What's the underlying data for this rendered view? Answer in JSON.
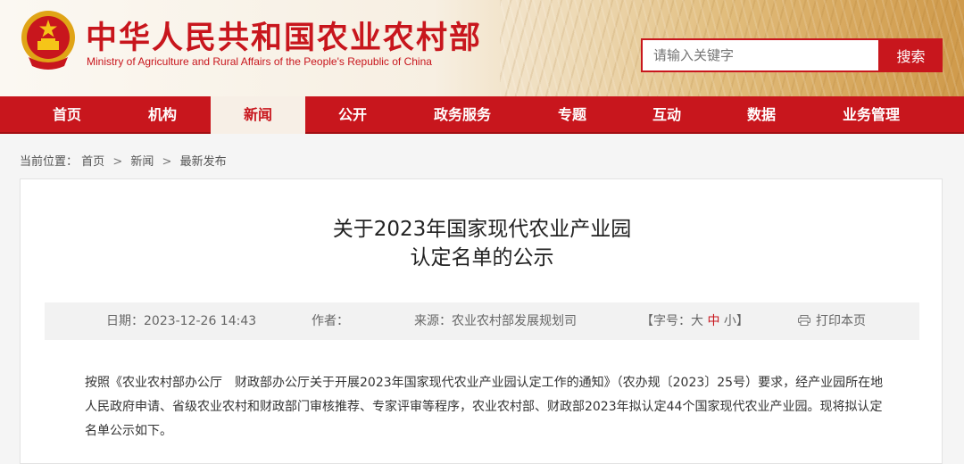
{
  "site": {
    "title": "中华人民共和国农业农村部",
    "subtitle": "Ministry of Agriculture and Rural Affairs of the People's Republic of China"
  },
  "search": {
    "placeholder": "请输入关键字",
    "button": "搜索"
  },
  "nav": [
    "首页",
    "机构",
    "新闻",
    "公开",
    "政务服务",
    "专题",
    "互动",
    "数据",
    "业务管理"
  ],
  "breadcrumb": {
    "label": "当前位置：",
    "items": [
      "首页",
      "新闻",
      "最新发布"
    ],
    "separator": ">"
  },
  "article": {
    "title_line1": "关于2023年国家现代农业产业园",
    "title_line2": "认定名单的公示",
    "meta": {
      "date_label": "日期：",
      "date": "2023-12-26 14:43",
      "author_label": "作者：",
      "source_label": "来源：",
      "source": "农业农村部发展规划司",
      "fontsize_label": "【字号：",
      "size_large": "大",
      "size_medium": "中",
      "size_small": "小",
      "fontsize_end": "】",
      "print": "打印本页"
    },
    "paragraph": "按照《农业农村部办公厅　财政部办公厅关于开展2023年国家现代农业产业园认定工作的通知》（农办规〔2023〕25号）要求，经产业园所在地人民政府申请、省级农业农村和财政部门审核推荐、专家评审等程序，农业农村部、财政部2023年拟认定44个国家现代农业产业园。现将拟认定名单公示如下。"
  },
  "colors": {
    "brand_red": "#c8161d",
    "meta_bg": "#f2f2f2",
    "active_nav_bg": "#f7efe6"
  },
  "icons": [
    "national-emblem-icon",
    "print-icon"
  ]
}
